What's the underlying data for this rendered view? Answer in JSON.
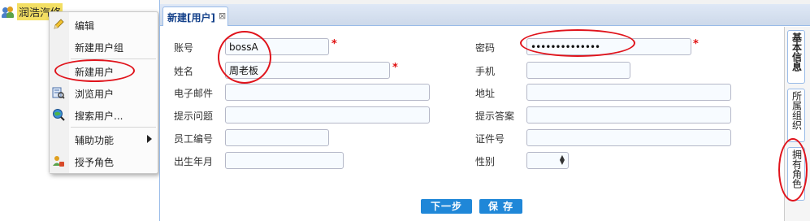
{
  "tree": {
    "root_label": "润浩汽修"
  },
  "context_menu": {
    "items": [
      {
        "label": "编辑",
        "icon": "pencil-icon"
      },
      {
        "label": "新建用户组",
        "icon": ""
      },
      {
        "label": "新建用户",
        "icon": ""
      },
      {
        "label": "浏览用户",
        "icon": "browse-icon"
      },
      {
        "label": "搜索用户...",
        "icon": "search-globe-icon"
      },
      {
        "label": "辅助功能",
        "icon": "",
        "submenu": true
      },
      {
        "label": "授予角色",
        "icon": "role-icon"
      }
    ]
  },
  "dialog": {
    "tab_title": "新建[用户]",
    "tab_close": "⊠",
    "fields": {
      "account": {
        "label": "账号",
        "value": "bossA",
        "required": "*"
      },
      "password": {
        "label": "密码",
        "value": "••••••••••••••",
        "required": "*"
      },
      "name": {
        "label": "姓名",
        "value": "周老板",
        "required": "*"
      },
      "phone": {
        "label": "手机",
        "value": ""
      },
      "email": {
        "label": "电子邮件",
        "value": ""
      },
      "address": {
        "label": "地址",
        "value": ""
      },
      "hint_question": {
        "label": "提示问题",
        "value": ""
      },
      "hint_answer": {
        "label": "提示答案",
        "value": ""
      },
      "employee_no": {
        "label": "员工编号",
        "value": ""
      },
      "id_no": {
        "label": "证件号",
        "value": ""
      },
      "birth": {
        "label": "出生年月",
        "value": ""
      },
      "gender": {
        "label": "性别",
        "value": ""
      }
    },
    "buttons": {
      "next": "下一步",
      "save": "保 存"
    },
    "side_tabs": [
      "基本信息",
      "所属组织",
      "拥有角色"
    ]
  },
  "colors": {
    "annotation": "#e0141c",
    "button": "#1f87d8",
    "tab_border": "#99bbe8",
    "tree_highlight": "#f3df63"
  }
}
